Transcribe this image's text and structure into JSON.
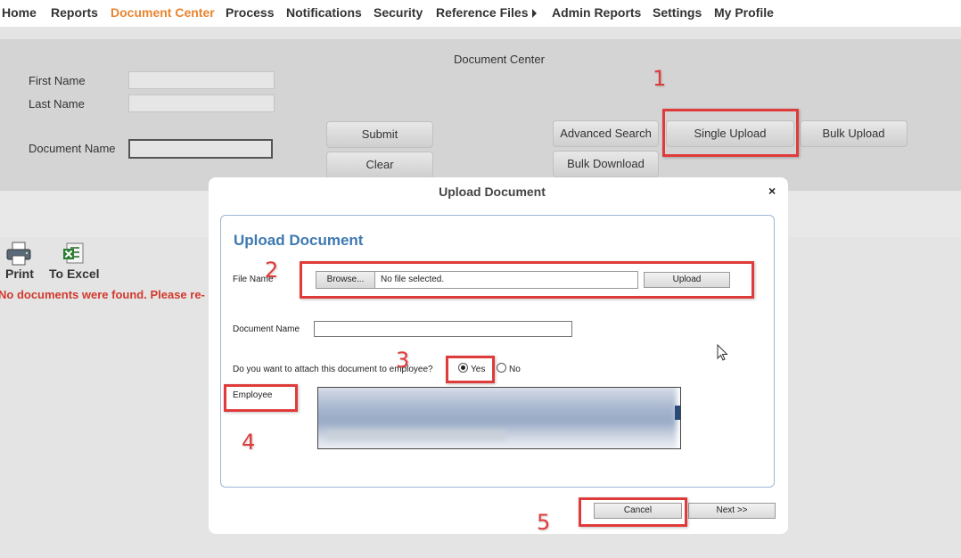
{
  "nav": {
    "items": [
      {
        "label": "Home"
      },
      {
        "label": "Reports"
      },
      {
        "label": "Document Center"
      },
      {
        "label": "Process"
      },
      {
        "label": "Notifications"
      },
      {
        "label": "Security"
      },
      {
        "label": "Reference Files"
      },
      {
        "label": "Admin Reports"
      },
      {
        "label": "Settings"
      },
      {
        "label": "My Profile"
      }
    ],
    "active": "Document Center",
    "active_color": "#e8842f"
  },
  "search": {
    "title": "Document Center",
    "first_name_label": "First Name",
    "last_name_label": "Last Name",
    "document_name_label": "Document Name",
    "first_name_value": "",
    "last_name_value": "",
    "document_name_value": "",
    "submit_label": "Submit",
    "clear_label": "Clear",
    "advanced_search_label": "Advanced Search",
    "single_upload_label": "Single Upload",
    "bulk_upload_label": "Bulk Upload",
    "bulk_download_label": "Bulk Download"
  },
  "toolbar": {
    "print_label": "Print",
    "excel_label": "To Excel"
  },
  "message": {
    "error": "No documents were found. Please re-",
    "error_color": "#d23a2d"
  },
  "modal": {
    "title": "Upload Document",
    "heading": "Upload Document",
    "heading_color": "#3e79b1",
    "file_name_label": "File Name",
    "browse_label": "Browse...",
    "file_status": "No file selected.",
    "upload_label": "Upload",
    "document_name_label": "Document Name",
    "document_name_value": "",
    "attach_question": "Do you want to attach this document to employee?",
    "yes_label": "Yes",
    "no_label": "No",
    "attach_selected": "Yes",
    "employee_label": "Employee",
    "cancel_label": "Cancel",
    "next_label": "Next >>",
    "close_icon": "×"
  },
  "annotations": {
    "color": "#e03b3b",
    "numbers": [
      "1",
      "2",
      "3",
      "4",
      "5"
    ]
  }
}
